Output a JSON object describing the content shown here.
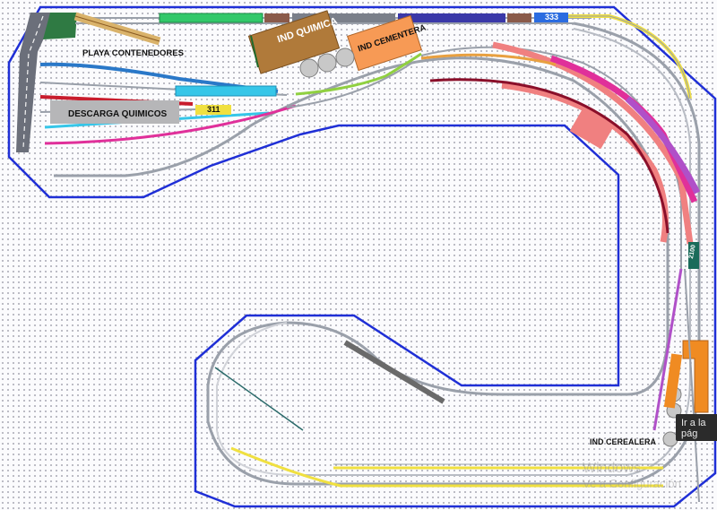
{
  "labels": {
    "playa_contenedores": "PLAYA CONTENEDORES",
    "descarga_quimicos": "DESCARGA QUIMICOS",
    "ind_quimica": "IND QUIMICA",
    "ind_cementera": "IND CEMENTERA",
    "ind_cerealera": "IND CEREALERA"
  },
  "locos": {
    "loco_333": "333",
    "loco_311": "311",
    "loco_2100": "2100"
  },
  "tooltip": "Ir a la pág",
  "watermark": {
    "line1": "Windows",
    "line2": "Ve a Configuración"
  },
  "colors": {
    "board_border": "#1f2fd6",
    "track": "#9aa0aa",
    "tan_building": "#b07a3a",
    "orange_building": "#f79a55",
    "pink_siding": "#f08080",
    "magenta_siding": "#e0309a",
    "violet_siding": "#b050c8",
    "maroon_siding": "#8a0f2a",
    "cyan_car": "#36c6e8",
    "yellow_track": "#f0e040"
  }
}
